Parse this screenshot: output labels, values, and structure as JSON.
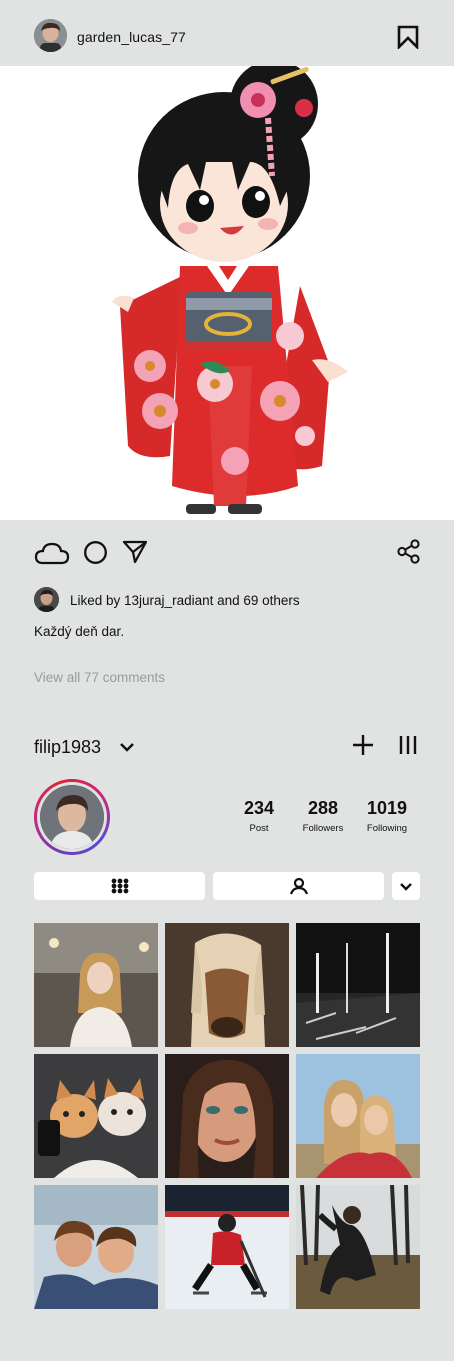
{
  "post": {
    "username": "garden_lucas_77",
    "likes_text": "Liked by 13juraj_radiant and 69 others",
    "caption": "Každý deň dar.",
    "view_comments": "View all 77 comments"
  },
  "profile": {
    "name": "filip1983",
    "stats": [
      {
        "value": "234",
        "label": "Post"
      },
      {
        "value": "288",
        "label": "Followers"
      },
      {
        "value": "1019",
        "label": "Following"
      }
    ]
  },
  "icons": {
    "header": [
      "avatar",
      "bookmark-icon"
    ],
    "actions": [
      "cloud-icon",
      "circle-icon",
      "send-icon",
      "share-icon"
    ],
    "profile": [
      "chevron-down-icon",
      "plus-icon",
      "menu-icon",
      "grid-icon",
      "tagged-user-icon",
      "chevron-down-icon"
    ]
  },
  "colors": {
    "background": "#e1e3e2",
    "text": "#111111",
    "muted": "#9a9c9b",
    "story_ring": [
      "#6a3fb3",
      "#c62a78",
      "#d7263d",
      "#5b47d6"
    ]
  }
}
